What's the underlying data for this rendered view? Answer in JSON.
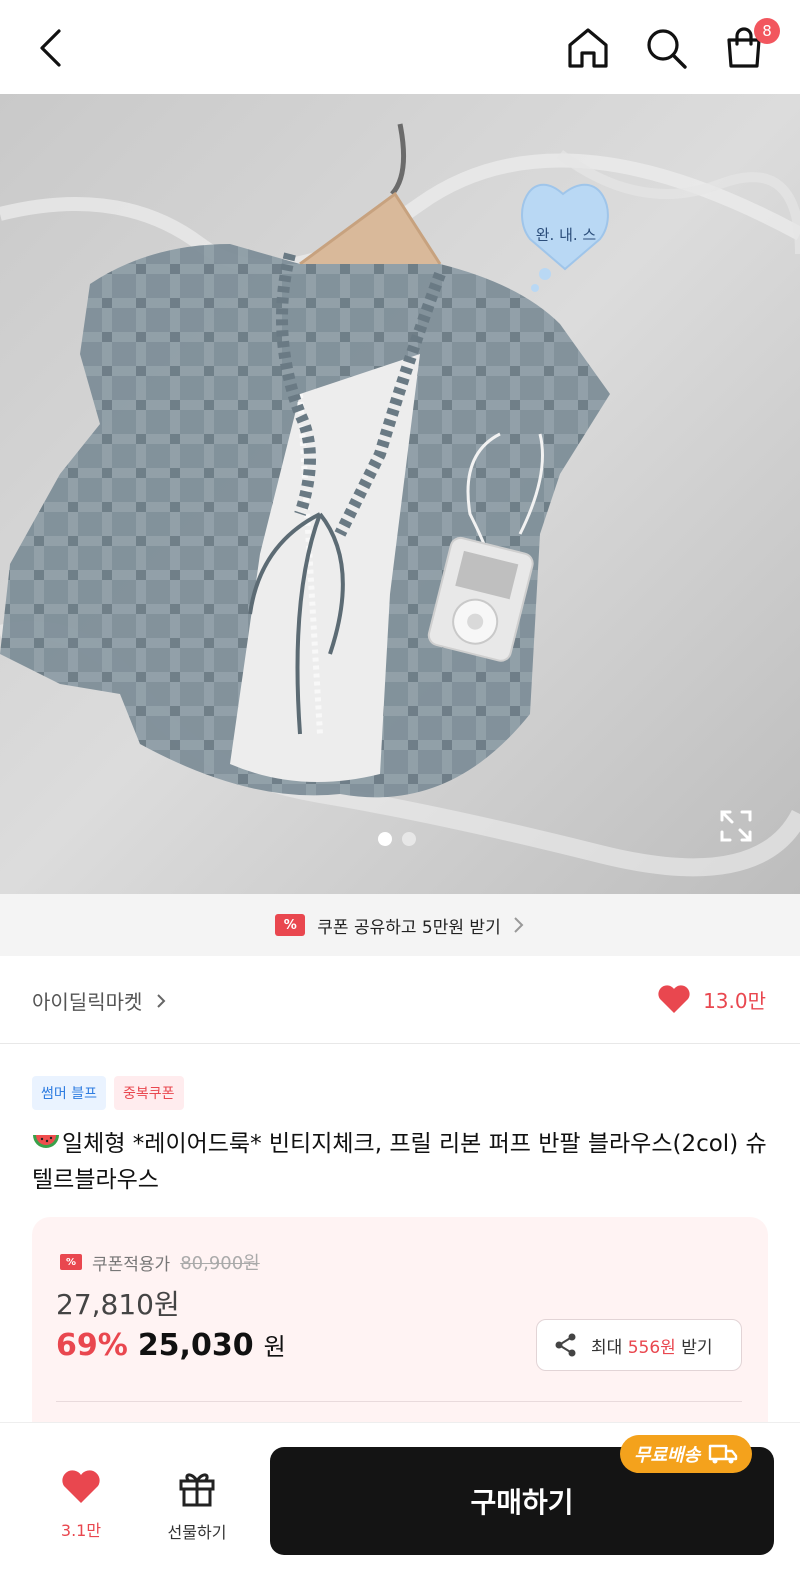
{
  "header": {
    "cart_count": "8"
  },
  "hero": {
    "bubble_text": "완. 내. 스",
    "current_slide": 1,
    "total_slides": 2
  },
  "coupon_bar": {
    "text": "쿠폰 공유하고 5만원 받기"
  },
  "store": {
    "name": "아이딜릭마켓",
    "likes": "13.0만"
  },
  "tags": [
    "썸머 블프",
    "중복쿠폰"
  ],
  "product": {
    "title": "일체형 *레이어드룩* 빈티지체크, 프릴 리본 퍼프 반팔 블라우스(2col) 슈텔르블라우스"
  },
  "price": {
    "coupon_label": "쿠폰적용가",
    "original": "80,900원",
    "coupon_price": "27,810원",
    "discount": "69%",
    "final_amount": "25,030",
    "final_unit": "원",
    "share_prefix": "최대",
    "share_amount": "556원",
    "share_suffix": "받기"
  },
  "bottom_bar": {
    "wish_count": "3.1만",
    "gift_label": "선물하기",
    "buy_label": "구매하기",
    "free_shipping": "무료배송"
  },
  "colors": {
    "accent": "#e9474f",
    "badge_orange": "#f4a21c",
    "buy_button": "#141414"
  }
}
